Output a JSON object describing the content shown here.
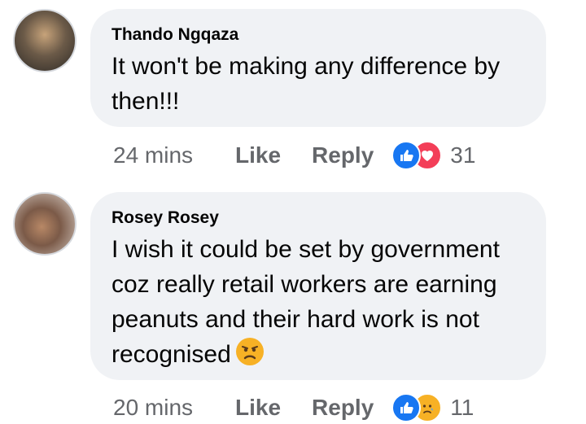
{
  "comments": [
    {
      "author": "Thando Ngqaza",
      "text_lines": [
        "It won't be making any difference by",
        "then!!!"
      ],
      "time": "24 mins",
      "like_label": "Like",
      "reply_label": "Reply",
      "reactions": [
        "like",
        "love"
      ],
      "reaction_count": "31"
    },
    {
      "author": "Rosey Rosey",
      "text_lines": [
        "I wish it could be set by government",
        "coz really retail workers are earning",
        "peanuts and their hard work is not",
        "recognised"
      ],
      "emoji": "frowning-face",
      "time": "20 mins",
      "like_label": "Like",
      "reply_label": "Reply",
      "reactions": [
        "like",
        "sad"
      ],
      "reaction_count": "11"
    }
  ],
  "colors": {
    "bubble": "#f0f2f5",
    "meta_text": "#65676b",
    "like_blue": "#1877f2",
    "love_red": "#f33e58",
    "sad_yellow": "#f7b125"
  }
}
